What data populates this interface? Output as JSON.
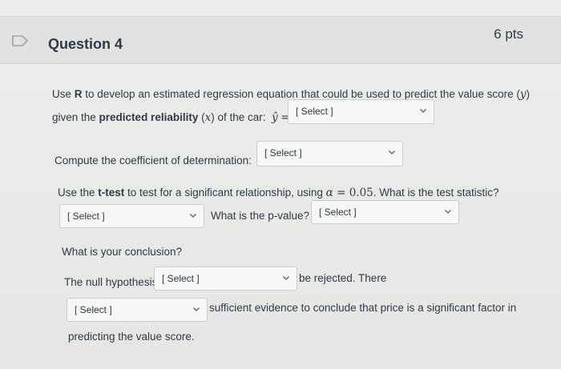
{
  "question": {
    "title": "Question 4",
    "points": "6 pts"
  },
  "q1": {
    "line1_pre": "Use ",
    "line1_bold": "R",
    "line1_post": " to develop an estimated regression equation that could be used to predict the value score (",
    "var_y": "y",
    "line1_end": ")",
    "line2_pre": "given the ",
    "line2_bold": "predicted reliability",
    "line2_mid": " (",
    "var_x": "x",
    "line2_post": ") of the car:",
    "yhat": "ŷ",
    "eq": "=",
    "select_label": "[ Select ]"
  },
  "q2": {
    "label": "Compute the coefficient of determination:",
    "select_label": "[ Select ]"
  },
  "q3": {
    "pre": "Use the ",
    "bold": "t-test",
    "mid": " to test for a significant relationship, using ",
    "alpha": "α",
    "eq": " = 0.05",
    "post": ". What is the test statistic?",
    "stat_select_label": "[ Select ]",
    "pvalue_label": "What is the p-value?",
    "pvalue_select_label": "[ Select ]"
  },
  "q4": {
    "conclusion_label": "What is your conclusion?",
    "null_pre": "The null hypothesis",
    "null_select_label": "[ Select ]",
    "null_post": "be rejected. There",
    "evidence_select_label": "[ Select ]",
    "evidence_post": "sufficient evidence to conclude that price is a significant factor in",
    "last_line": "predicting the value score."
  }
}
